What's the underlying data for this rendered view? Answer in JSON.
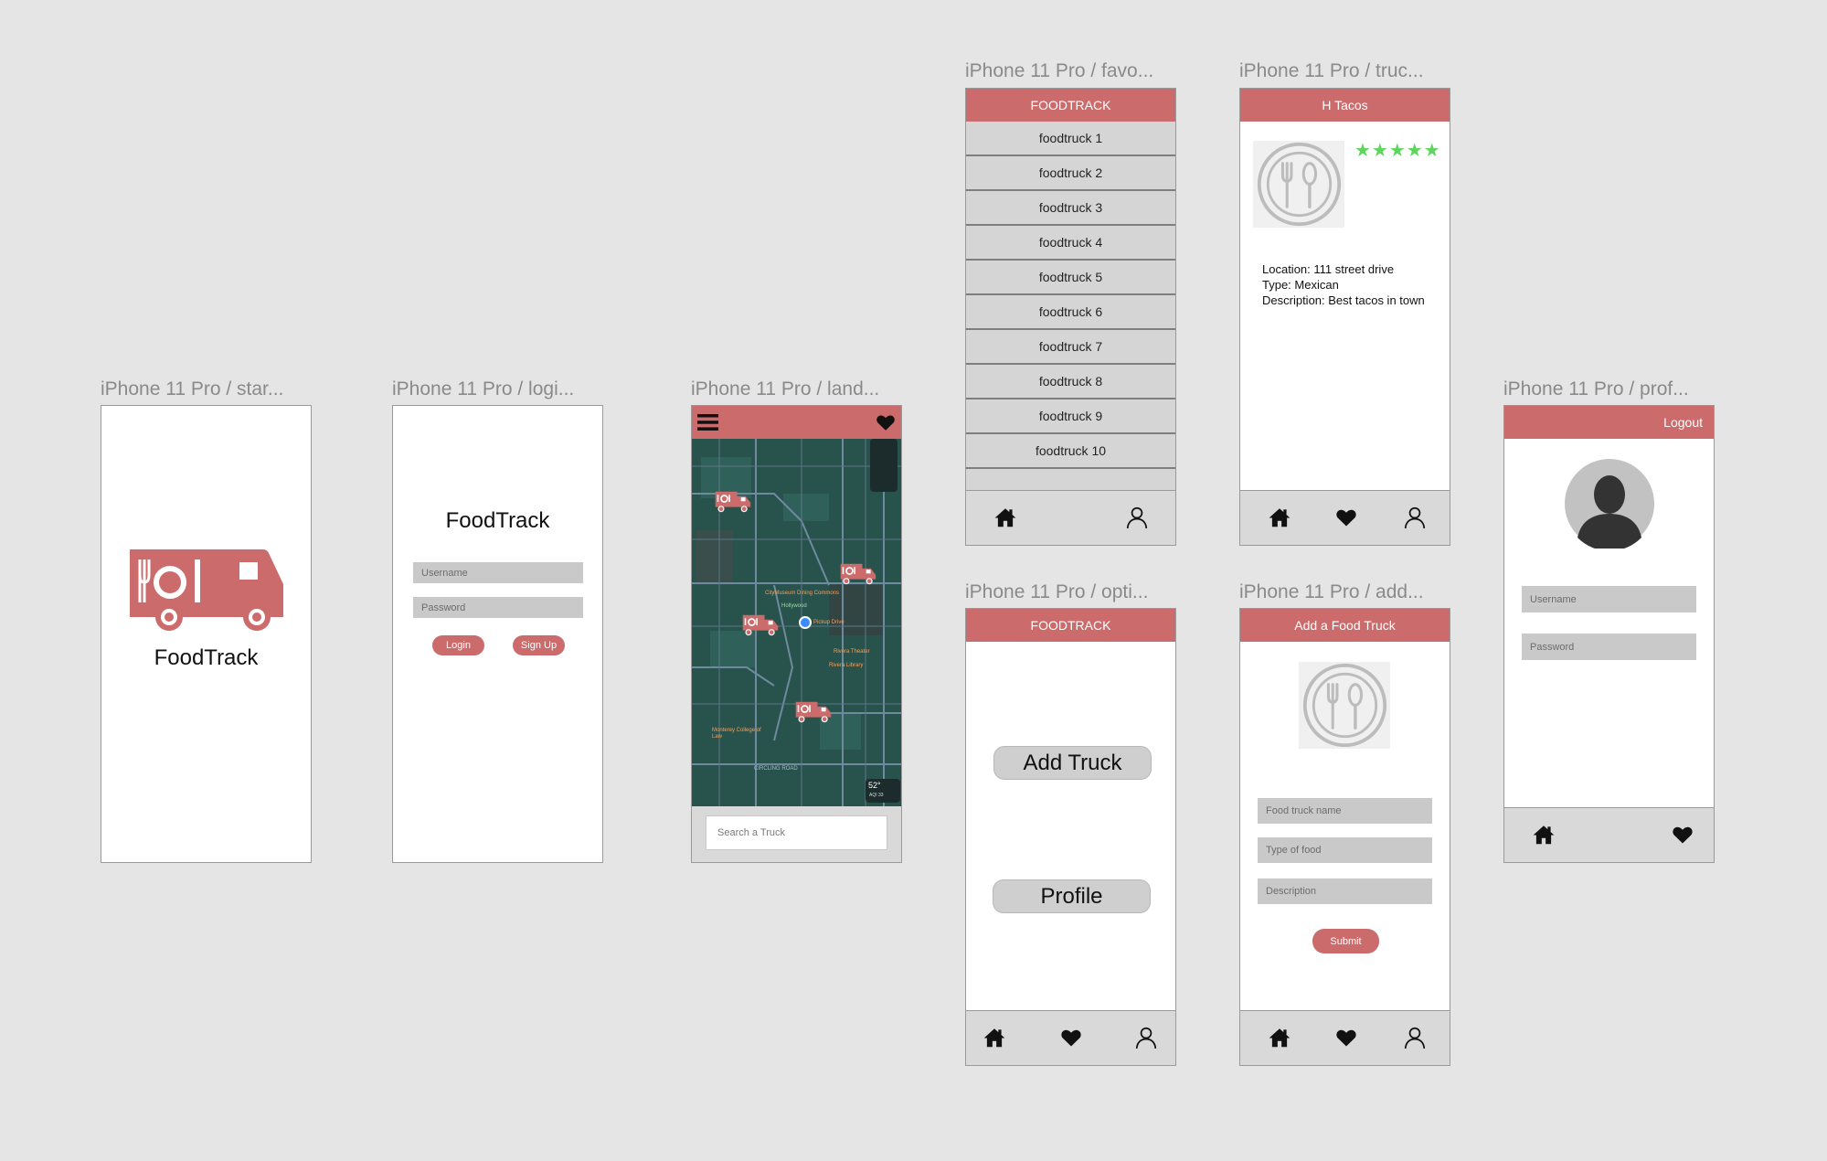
{
  "colors": {
    "accent": "#cc6b6b",
    "nav": "#d9d9d9",
    "field": "#c9c9c9",
    "stars": "#5cd65c",
    "map": "#28534d"
  },
  "frames": {
    "start": {
      "label": "iPhone 11 Pro / star...",
      "app_name": "FoodTrack"
    },
    "login": {
      "label": "iPhone 11 Pro / logi...",
      "title": "FoodTrack",
      "username_placeholder": "Username",
      "password_placeholder": "Password",
      "login_label": "Login",
      "signup_label": "Sign Up"
    },
    "landing": {
      "label": "iPhone 11 Pro / land...",
      "search_placeholder": "Search a Truck",
      "weather": "52°",
      "weather_sub": "AQI 33",
      "map_labels": [
        "CityMuseum Dining Commons",
        "Pickup Drive",
        "Hollywood",
        "Rivera Theater",
        "Rivera Library",
        "Monterey College of Law",
        "CIRCLING ROAD"
      ]
    },
    "favorites": {
      "label": "iPhone 11 Pro / favo...",
      "header": "FOODTRACK",
      "items": [
        "foodtruck 1",
        "foodtruck 2",
        "foodtruck 3",
        "foodtruck 4",
        "foodtruck 5",
        "foodtruck 6",
        "foodtruck 7",
        "foodtruck 8",
        "foodtruck 9",
        "foodtruck 10"
      ]
    },
    "truck": {
      "label": "iPhone 11 Pro / truc...",
      "header": "H Tacos",
      "stars": "★★★★★",
      "location": "Location: 111 street drive",
      "type": "Type: Mexican",
      "description": "Description: Best tacos in town"
    },
    "options": {
      "label": "iPhone 11 Pro / opti...",
      "header": "FOODTRACK",
      "add_truck": "Add Truck",
      "profile": "Profile"
    },
    "add": {
      "label": "iPhone 11 Pro / add...",
      "header": "Add a Food Truck",
      "name_placeholder": "Food truck name",
      "type_placeholder": "Type of food",
      "desc_placeholder": "Description",
      "submit": "Submit"
    },
    "profile": {
      "label": "iPhone 11 Pro / prof...",
      "logout": "Logout",
      "username_placeholder": "Username",
      "password_placeholder": "Password"
    }
  },
  "icons": {
    "home": "home-icon",
    "heart": "heart-icon",
    "user": "user-icon",
    "menu": "menu-icon",
    "logo": "food-truck-logo",
    "placeholder": "utensils-icon"
  }
}
